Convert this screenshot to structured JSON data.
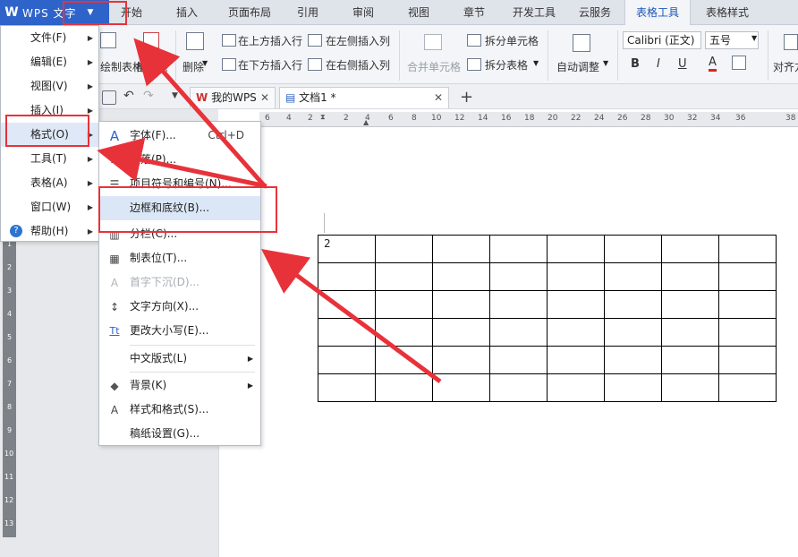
{
  "app": {
    "name": "WPS 文字",
    "logo": "W"
  },
  "ribbon_tabs": [
    "开始",
    "插入",
    "页面布局",
    "引用",
    "审阅",
    "视图",
    "章节",
    "开发工具",
    "云服务",
    "表格工具",
    "表格样式"
  ],
  "ribbon": {
    "draw_table": "绘制表格",
    "eraser": "橡皮擦",
    "delete": "删除",
    "insert_above": "在上方插入行",
    "insert_below": "在下方插入行",
    "insert_left": "在左侧插入列",
    "insert_right": "在右侧插入列",
    "merge_cells": "合并单元格",
    "split_cells": "拆分单元格",
    "split_table": "拆分表格",
    "auto_fit": "自动调整",
    "font_name": "Calibri (正文)",
    "font_size": "五号",
    "align": "对齐方式",
    "bold": "B",
    "italic": "I",
    "underline": "U",
    "font_color": "A"
  },
  "doc_tabs": [
    "我的WPS",
    "文档1 *"
  ],
  "ruler_numbers": [
    "6",
    "4",
    "2",
    "2",
    "4",
    "6",
    "8",
    "10",
    "12",
    "14",
    "16",
    "18",
    "20",
    "22",
    "24",
    "26",
    "28",
    "30",
    "32",
    "34",
    "36",
    "38"
  ],
  "vertical_ruler": [
    "1",
    "2",
    "3",
    "4",
    "5",
    "6",
    "7",
    "8",
    "9",
    "10",
    "11",
    "12",
    "13"
  ],
  "main_menu": [
    {
      "label": "文件(F)",
      "submenu": true
    },
    {
      "label": "编辑(E)",
      "submenu": true
    },
    {
      "label": "视图(V)",
      "submenu": true
    },
    {
      "label": "插入(I)",
      "submenu": true
    },
    {
      "label": "格式(O)",
      "submenu": true
    },
    {
      "label": "工具(T)",
      "submenu": true
    },
    {
      "label": "表格(A)",
      "submenu": true
    },
    {
      "label": "窗口(W)",
      "submenu": true
    },
    {
      "label": "帮助(H)",
      "submenu": true
    }
  ],
  "format_menu": [
    {
      "label": "字体(F)...",
      "shortcut": "Ctrl+D",
      "icon": "A"
    },
    {
      "label": "段落(P)...",
      "icon": "≡"
    },
    {
      "label": "项目符号和编号(N)...",
      "icon": "☰"
    },
    {
      "label": "边框和底纹(B)...",
      "icon": ""
    },
    {
      "label": "分栏(C)...",
      "icon": "▥"
    },
    {
      "label": "制表位(T)...",
      "icon": "▦"
    },
    {
      "label": "首字下沉(D)...",
      "icon": "A"
    },
    {
      "label": "文字方向(X)...",
      "icon": "↕"
    },
    {
      "label": "更改大小写(E)...",
      "icon": "Tt"
    },
    {
      "label": "中文版式(L)",
      "icon": ""
    },
    {
      "label": "背景(K)",
      "icon": "◆"
    },
    {
      "label": "样式和格式(S)...",
      "icon": "A"
    },
    {
      "label": "稿纸设置(G)...",
      "icon": ""
    }
  ],
  "table_first_cell": "2",
  "colors": {
    "accent": "#2e63c9",
    "annotation": "#e8323a",
    "highlight": "#dbe7f7"
  }
}
